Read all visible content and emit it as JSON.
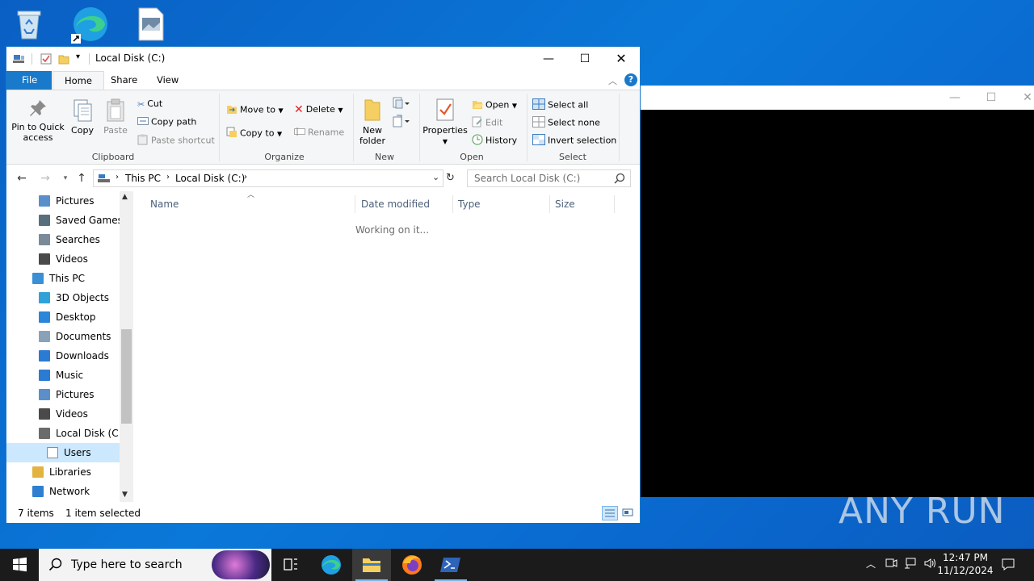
{
  "explorer": {
    "title": "Local Disk (C:)",
    "tabs": [
      "File",
      "Home",
      "Share",
      "View"
    ],
    "ribbon": {
      "clipboard": {
        "label": "Clipboard",
        "pin": "Pin to Quick access",
        "copy": "Copy",
        "paste": "Paste",
        "cut": "Cut",
        "copy_path": "Copy path",
        "paste_shortcut": "Paste shortcut"
      },
      "organize": {
        "label": "Organize",
        "move_to": "Move to",
        "copy_to": "Copy to",
        "delete": "Delete",
        "rename": "Rename"
      },
      "new": {
        "label": "New",
        "new_folder": "New folder"
      },
      "open": {
        "label": "Open",
        "properties": "Properties",
        "open": "Open",
        "edit": "Edit",
        "history": "History"
      },
      "select": {
        "label": "Select",
        "select_all": "Select all",
        "select_none": "Select none",
        "invert": "Invert selection"
      }
    },
    "address": {
      "crumbs": [
        "This PC",
        "Local Disk (C:)"
      ],
      "search_placeholder": "Search Local Disk (C:)"
    },
    "nav_items": [
      {
        "label": "Pictures",
        "icon": "pictures-icon",
        "level": 2
      },
      {
        "label": "Saved Games",
        "icon": "saved-games-icon",
        "level": 2
      },
      {
        "label": "Searches",
        "icon": "search-folder-icon",
        "level": 2
      },
      {
        "label": "Videos",
        "icon": "videos-icon",
        "level": 2
      },
      {
        "label": "This PC",
        "icon": "computer-icon",
        "level": 1
      },
      {
        "label": "3D Objects",
        "icon": "3d-objects-icon",
        "level": 2
      },
      {
        "label": "Desktop",
        "icon": "desktop-icon",
        "level": 2
      },
      {
        "label": "Documents",
        "icon": "documents-icon",
        "level": 2
      },
      {
        "label": "Downloads",
        "icon": "downloads-icon",
        "level": 2
      },
      {
        "label": "Music",
        "icon": "music-icon",
        "level": 2
      },
      {
        "label": "Pictures",
        "icon": "pictures-icon",
        "level": 2
      },
      {
        "label": "Videos",
        "icon": "videos-icon",
        "level": 2
      },
      {
        "label": "Local Disk (C:)",
        "icon": "drive-icon",
        "level": 2
      },
      {
        "label": "Users",
        "icon": "folder-icon",
        "level": 3,
        "selected": true
      },
      {
        "label": "Libraries",
        "icon": "libraries-icon",
        "level": 1
      },
      {
        "label": "Network",
        "icon": "network-icon",
        "level": 1
      }
    ],
    "columns": [
      "Name",
      "Date modified",
      "Type",
      "Size"
    ],
    "working_text": "Working on it...",
    "status": {
      "items": "7 items",
      "selected": "1 item selected"
    }
  },
  "taskbar": {
    "search_placeholder": "Type here to search",
    "time": "12:47 PM",
    "date": "11/12/2024"
  },
  "watermark": "ANY RUN"
}
